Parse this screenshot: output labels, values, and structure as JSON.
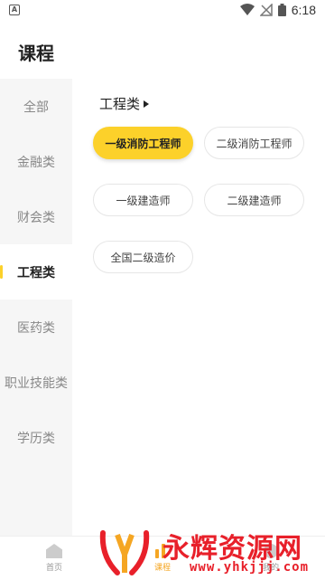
{
  "status_bar": {
    "app_icon_letter": "A",
    "time": "6:18"
  },
  "page_title": "课程",
  "sidebar": {
    "items": [
      {
        "label": "全部"
      },
      {
        "label": "金融类"
      },
      {
        "label": "财会类"
      },
      {
        "label": "工程类",
        "active": true
      },
      {
        "label": "医药类"
      },
      {
        "label": "职业技能类"
      },
      {
        "label": "学历类"
      }
    ]
  },
  "section": {
    "title": "工程类"
  },
  "courses": [
    {
      "label": "一级消防工程师",
      "selected": true
    },
    {
      "label": "二级消防工程师"
    },
    {
      "label": "一级建造师"
    },
    {
      "label": "二级建造师"
    },
    {
      "label": "全国二级造价"
    }
  ],
  "bottom_nav": {
    "items": [
      {
        "label": "首页",
        "icon": "home-icon"
      },
      {
        "label": "课程",
        "icon": "course-icon",
        "active": true
      },
      {
        "label": "我的",
        "icon": "profile-icon"
      }
    ]
  },
  "watermark": {
    "text": "永辉资源网",
    "url": "www.yhkjjj.com"
  },
  "colors": {
    "accent": "#fcd12a",
    "watermark": "#e8202a"
  }
}
